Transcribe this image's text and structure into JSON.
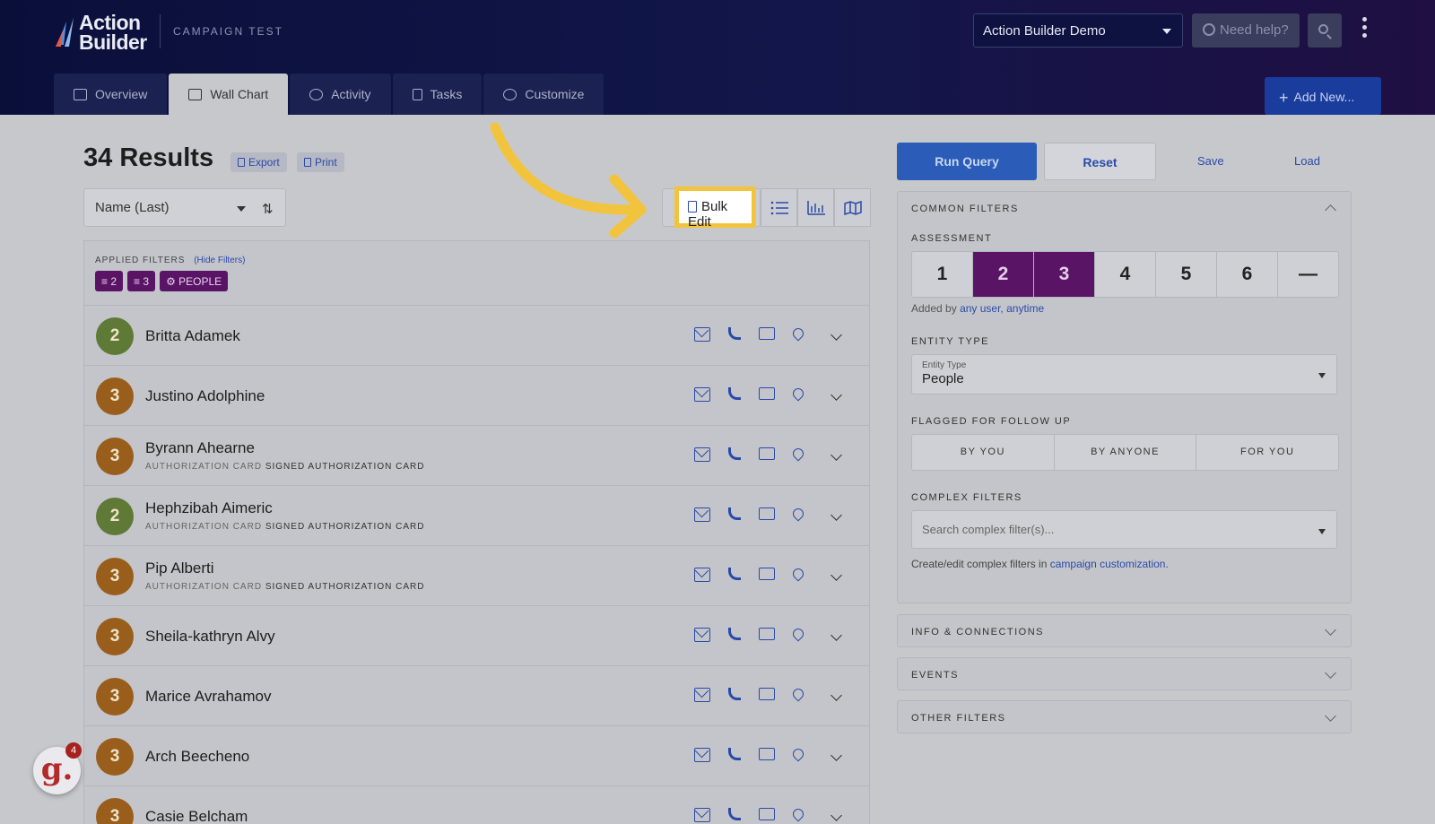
{
  "header": {
    "logo_line1": "Action",
    "logo_line2": "Builder",
    "campaign": "CAMPAIGN TEST",
    "org_select": "Action Builder Demo",
    "help": "Need help?",
    "add_new": "Add New..."
  },
  "tabs": [
    {
      "label": "Overview",
      "icon": "book-icon"
    },
    {
      "label": "Wall Chart",
      "icon": "table-icon",
      "active": true
    },
    {
      "label": "Activity",
      "icon": "history-icon"
    },
    {
      "label": "Tasks",
      "icon": "clipboard-icon"
    },
    {
      "label": "Customize",
      "icon": "gears-icon"
    }
  ],
  "results": {
    "title": "34 Results",
    "export": "Export",
    "print": "Print",
    "sort": "Name (Last)",
    "bulk_edit": "Bulk Edit"
  },
  "applied_filters": {
    "label": "APPLIED FILTERS",
    "hide": "(Hide Filters)",
    "chips": [
      "2",
      "3",
      "PEOPLE"
    ]
  },
  "people": [
    {
      "score": "2",
      "name": "Britta Adamek",
      "sub_label": "",
      "sub_value": "",
      "color": "#5e7a36"
    },
    {
      "score": "3",
      "name": "Justino Adolphine",
      "sub_label": "",
      "sub_value": "",
      "color": "#9a5e1c"
    },
    {
      "score": "3",
      "name": "Byrann Ahearne",
      "sub_label": "AUTHORIZATION CARD",
      "sub_value": "SIGNED AUTHORIZATION CARD",
      "color": "#9a5e1c"
    },
    {
      "score": "2",
      "name": "Hephzibah Aimeric",
      "sub_label": "AUTHORIZATION CARD",
      "sub_value": "SIGNED AUTHORIZATION CARD",
      "color": "#5e7a36"
    },
    {
      "score": "3",
      "name": "Pip Alberti",
      "sub_label": "AUTHORIZATION CARD",
      "sub_value": "SIGNED AUTHORIZATION CARD",
      "color": "#9a5e1c"
    },
    {
      "score": "3",
      "name": "Sheila-kathryn Alvy",
      "sub_label": "",
      "sub_value": "",
      "color": "#9a5e1c"
    },
    {
      "score": "3",
      "name": "Marice Avrahamov",
      "sub_label": "",
      "sub_value": "",
      "color": "#9a5e1c"
    },
    {
      "score": "3",
      "name": "Arch Beecheno",
      "sub_label": "",
      "sub_value": "",
      "color": "#9a5e1c"
    },
    {
      "score": "3",
      "name": "Casie Belcham",
      "sub_label": "",
      "sub_value": "",
      "color": "#9a5e1c"
    }
  ],
  "query": {
    "run": "Run Query",
    "reset": "Reset",
    "save": "Save",
    "load": "Load"
  },
  "filters": {
    "common": "COMMON FILTERS",
    "assessment_label": "ASSESSMENT",
    "assessment": [
      "1",
      "2",
      "3",
      "4",
      "5",
      "6",
      "—"
    ],
    "assessment_selected": [
      "2",
      "3"
    ],
    "added_by_prefix": "Added by",
    "added_by_value": "any user, anytime",
    "entity_type_label": "ENTITY TYPE",
    "entity_type_inner": "Entity Type",
    "entity_type_value": "People",
    "flagged_label": "FLAGGED FOR FOLLOW UP",
    "flagged": [
      "BY YOU",
      "BY ANYONE",
      "FOR YOU"
    ],
    "complex_label": "COMPLEX FILTERS",
    "complex_placeholder": "Search complex filter(s)...",
    "complex_note_prefix": "Create/edit complex filters in",
    "complex_note_link": "campaign customization.",
    "info": "INFO & CONNECTIONS",
    "events": "EVENTS",
    "other": "OTHER FILTERS"
  },
  "widget": {
    "letter": "g.",
    "badge": "4"
  },
  "colors": {
    "accent": "#2a5cb8",
    "selected": "#5a1466",
    "highlight": "#f2c43d"
  }
}
